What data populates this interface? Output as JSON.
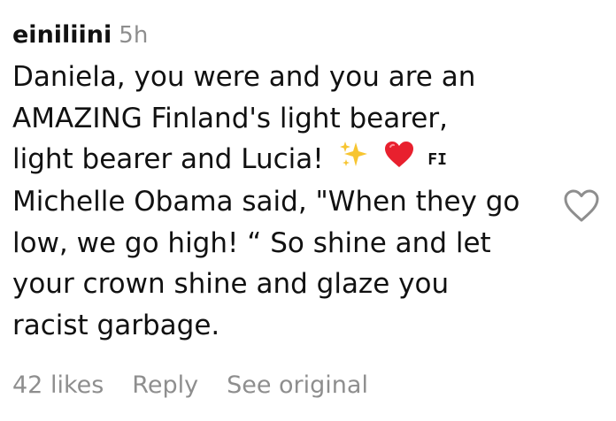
{
  "comment": {
    "username": "einiliini",
    "timestamp": "5h",
    "lines": [
      "Daniela, you were and you are an",
      "AMAZING Finland's light bearer,",
      "light bearer and Lucia!",
      "Michelle Obama said, \"When they go",
      "low, we go high! “ So shine and let",
      "your crown shine and glaze you",
      "racist garbage."
    ],
    "flag_text": "FI",
    "icons": {
      "sparkles": "sparkles-icon",
      "heart": "red-heart-icon",
      "like": "heart-outline-icon"
    },
    "colors": {
      "sparkles": "#f7c531",
      "heart": "#e8202e",
      "meta": "#8e8e8e"
    }
  },
  "footer": {
    "likes": "42 likes",
    "reply": "Reply",
    "see_original": "See original"
  }
}
